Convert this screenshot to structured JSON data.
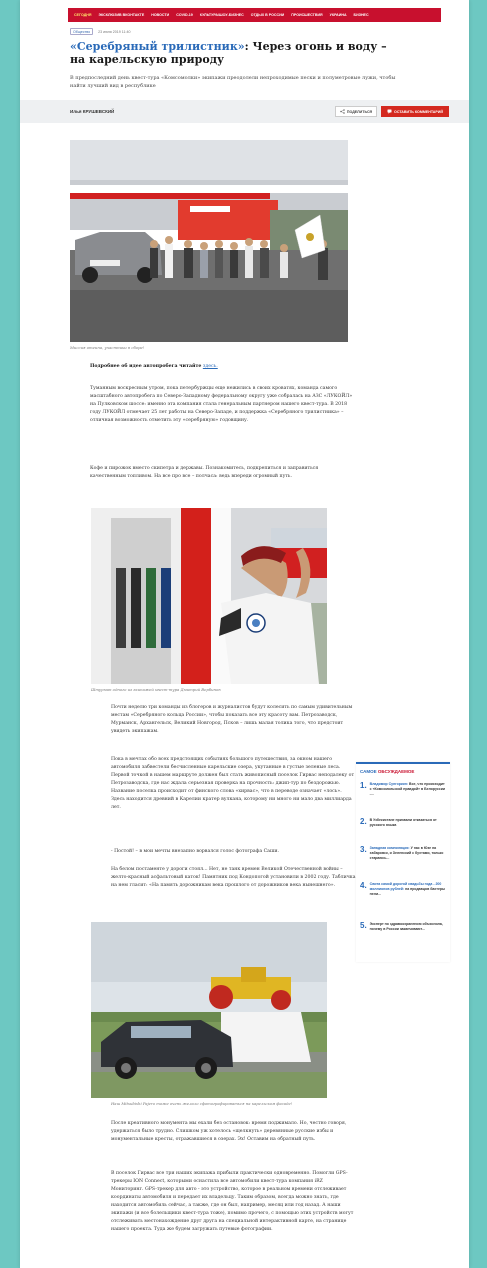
{
  "nav": {
    "items": [
      "Сегодня",
      "Эксклюзив ВКонтакте",
      "Новости",
      "Covid-19",
      "Культура/Шоу-бизнес",
      "Отдых в России",
      "Происшествия",
      "Украина",
      "Бизнес"
    ]
  },
  "meta": {
    "tag": "Общество",
    "date": "23 июля 2019 11:40"
  },
  "article": {
    "title_highlight": "«Серебряный трилистник»",
    "title_rest": ": Через огонь и воду – на карельскую природу",
    "lead": "В предпоследний день квест-тура «Комсомолки» экипажи преодолели непроходимые пески и полуметровые лужи, чтобы найти лучший вид в республике",
    "author": "Илья КРУШЕВСКИЙ",
    "share_label": "ПОДЕЛИТЬСЯ",
    "comment_label": "ОСТАВИТЬ КОММЕНТАРИЙ",
    "caption1": "Миссия отеина, участники в сборе!",
    "more_bold": "Подробнее об идее автопробега читайте",
    "more_link": "здесь.",
    "p1": "Туманным воскресным утром, пока петербуржцы еще нежились в своих кроватях, команда самого масштабного автопробега по Северо-Западному федеральному округу уже собралась на АЗС «ЛУКОЙЛ» на Пулковском шоссе: именно эта компания стала генеральным партнером нашего квест-тура. В 2018 году ЛУКОЙЛ отмечает 25 лет работы на Северо-Западе, и поддержка «Серебряного трилистника» – отличная возможность отметить эту «серебряную» годовщину.",
    "p2": "Кофе и пирожок вместо скипетра и державы. Познакомитесь, подкрепиться и заправиться качественным топливом. На все про все – полчаса: ведь впереди огромный путь.",
    "caption2": "Штурман одного из экипажей квест-тура Дмитрий Вербинов",
    "p3": "Почти неделю три команды из блогеров и журналистов будут колесить по самым удивительным местам «Серебряного кольца России», чтобы показать все эту красоту вам. Петрозаводск, Мурманск, Архангельск, Великий Новгород, Псков – лишь малая толика того, что предстоит увидеть экипажам.",
    "p4": "Пока в мечтах обо всех предстоящих событиях большого путешествия, за окном нашего автомобиля забвестели бесчисленные карельские озера, укутанные в густые зеленые леса. Первой точкой в нашем маршруте должен был стать живописный поселок Гирвас неподалеку от Петрозаводска, где нас ждала серьезная проверка на прочность: джип-тур по бездорожью. Название поселка происходит от финского слова «хирвас», что в переводе означает «лось». Здесь находится древний в Карелии кратер вулкана, которому ни много ни мало два миллиарда лет.",
    "p5": "- Постой! – в мои мечты внезапно ворвался голос фотографа Саши.",
    "p6": "На белом постаменте у дороги стоял... Нет, не танк времен Великой Отечественной войны – желто-красный асфальтовый каток! Памятник под Кондопогой установили в 2002 году. Табличка на нем гласит: «На память дорожникам века прошлого от дорожников века нынешнего».",
    "caption3": "Наш Mitsubishi Pajero тоже очень желало сфотографироваться на карельском фасаде!",
    "p7": "После креативного монумента мы ехали без остановок: время поджимало. Но, честно говоря, удержаться было трудно. Слишком уж хотелось «щелкнуть» деревянные русские избы и монументальные кресты, отражавшиеся в озерах. Эх! Оставим на обратный путь.",
    "p8": "В поселок Гирвас все три наших экипажа прибыли практически одновременно. Помогли GPS-трекеры ION Connect, которыми оснастила все автомобили квест-тура компания iRZ Мониторинг. GPS-трекер для авто - это устройство, которое в реальном времени отслеживает координаты автомобиля и передает их владельцу. Таким образом, всегда можно знать, где находится автомобиль сейчас, а также, где он был, например, месяц или год назад. А наши экипажи (и все болельщики квест-тура тоже), помимо прочего, с помощью этих устройств могут отслеживать местонахождение друг друга на специальной интерактивной карте, на странице нашего проекта. Туда же будем загружать путевые фотографии."
  },
  "sidebar": {
    "title_a": "САМОЕ",
    "title_b": "ОБСУЖДАЕМОЕ",
    "items": [
      {
        "num": "1.",
        "hl": "Владимир Сунгоркин:",
        "text": "Все, что происходит с «Комсомольской правдой» в Белоруссии -..."
      },
      {
        "num": "2.",
        "hl": "",
        "text": "В Узбекистане призвали отказаться от русского языка"
      },
      {
        "num": "3.",
        "hl": "Западная компиляция:",
        "text": "У нас в Юзе на хабаровск, и Зеленский с бухтами, только стараюсь..."
      },
      {
        "num": "4.",
        "hl": "Свита самой дорогой свадьбы года - 200 миллионов рублей:",
        "text": "на продавцов бахтеры пели..."
      },
      {
        "num": "5.",
        "hl": "",
        "text": "Эксперт по здравоохранению объяснила, почему в России заканчивают..."
      }
    ]
  },
  "colors": {
    "nav": "#c8102e",
    "accent": "#2a6ab8",
    "page_bg": "#6dc8c2"
  }
}
